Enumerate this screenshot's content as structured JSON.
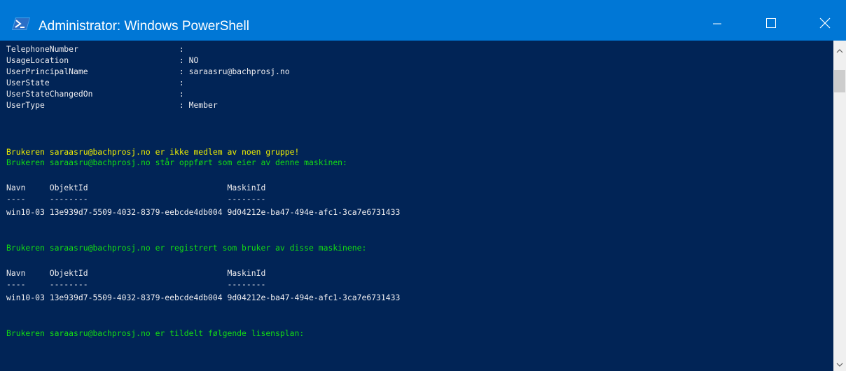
{
  "window": {
    "title": "Administrator: Windows PowerShell",
    "icon": "powershell-icon",
    "controls": [
      "minimize-icon",
      "maximize-icon",
      "close-icon"
    ]
  },
  "colors": {
    "title_bar": "#0077d6",
    "console_background": "#012456",
    "console_text": "#eeedf0",
    "warning_text": "#f0f000",
    "success_text": "#13dc13"
  },
  "console": {
    "lines": [
      "TelephoneNumber                     :",
      "UsageLocation                       : NO",
      "UserPrincipalName                   : saraasru@bachprosj.no",
      "UserState                           :",
      "UserStateChangedOn                  :",
      "UserType                            : Member",
      "Brukeren saraasru@bachprosj.no er ikke medlem av noen gruppe!",
      "Brukeren saraasru@bachprosj.no står oppført som eier av denne maskinen:",
      "Navn     ObjektId                             MaskinId",
      "----     --------                             --------",
      "win10-03 13e939d7-5509-4032-8379-eebcde4db004 9d04212e-ba47-494e-afc1-3ca7e6731433",
      "Brukeren saraasru@bachprosj.no er registrert som bruker av disse maskinene:",
      "Navn     ObjektId                             MaskinId",
      "----     --------                             --------",
      "win10-03 13e939d7-5509-4032-8379-eebcde4db004 9d04212e-ba47-494e-afc1-3ca7e6731433",
      "Brukeren saraasru@bachprosj.no er tildelt følgende lisensplan:"
    ]
  },
  "scrollbar": {
    "icons": [
      "scroll-up-icon",
      "scroll-down-icon"
    ]
  }
}
